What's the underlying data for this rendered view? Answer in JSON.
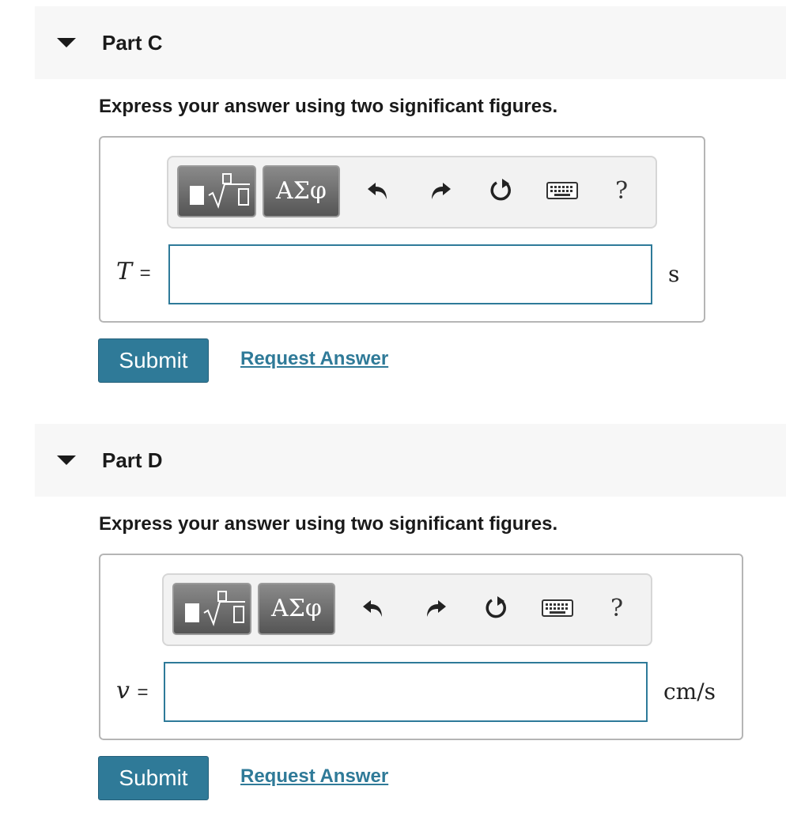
{
  "parts": [
    {
      "title": "Part C",
      "instructions": "Express your answer using two significant figures.",
      "toolbar": {
        "templates_icon": "templates-icon",
        "symbols_label": "ΑΣφ",
        "undo_icon": "undo-icon",
        "redo_icon": "redo-icon",
        "reset_icon": "reset-icon",
        "keyboard_icon": "keyboard-icon",
        "help_label": "?"
      },
      "variable": "T",
      "equals": "=",
      "input_value": "",
      "unit": "s",
      "submit_label": "Submit",
      "request_label": "Request Answer"
    },
    {
      "title": "Part D",
      "instructions": "Express your answer using two significant figures.",
      "toolbar": {
        "templates_icon": "templates-icon",
        "symbols_label": "ΑΣφ",
        "undo_icon": "undo-icon",
        "redo_icon": "redo-icon",
        "reset_icon": "reset-icon",
        "keyboard_icon": "keyboard-icon",
        "help_label": "?"
      },
      "variable": "v",
      "equals": "=",
      "input_value": "",
      "unit": "cm/s",
      "submit_label": "Submit",
      "request_label": "Request Answer"
    }
  ],
  "colors": {
    "accent": "#2f7a98",
    "header_bg": "#f7f7f7",
    "input_border": "#2e7a99"
  }
}
